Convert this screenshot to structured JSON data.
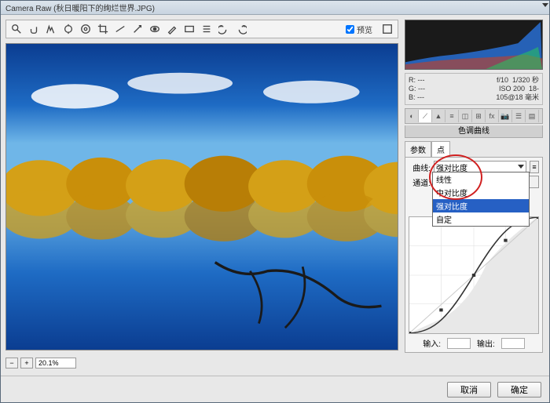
{
  "window": {
    "title": "Camera Raw (秋日暖阳下的绚烂世界.JPG)"
  },
  "toolbar": {
    "preview_label": "预览"
  },
  "zoom": {
    "value": "20.1%"
  },
  "info": {
    "r_label": "R:",
    "r_val": "---",
    "g_label": "G:",
    "g_val": "---",
    "b_label": "B:",
    "b_val": "---",
    "aperture": "f/10",
    "shutter": "1/320 秒",
    "iso_label": "ISO 200",
    "lens": "18-105@18 毫米"
  },
  "panel": {
    "title": "色调曲线",
    "subtab_param": "参数",
    "subtab_point": "点"
  },
  "curve": {
    "label_curve": "曲线:",
    "value_curve": "强对比度",
    "label_channel": "通道:",
    "dd": {
      "opt1": "线性",
      "opt2": "中对比度",
      "opt3": "强对比度",
      "opt4": "自定"
    },
    "input_label": "输入:",
    "output_label": "输出:"
  },
  "buttons": {
    "cancel": "取消",
    "ok": "确定"
  }
}
